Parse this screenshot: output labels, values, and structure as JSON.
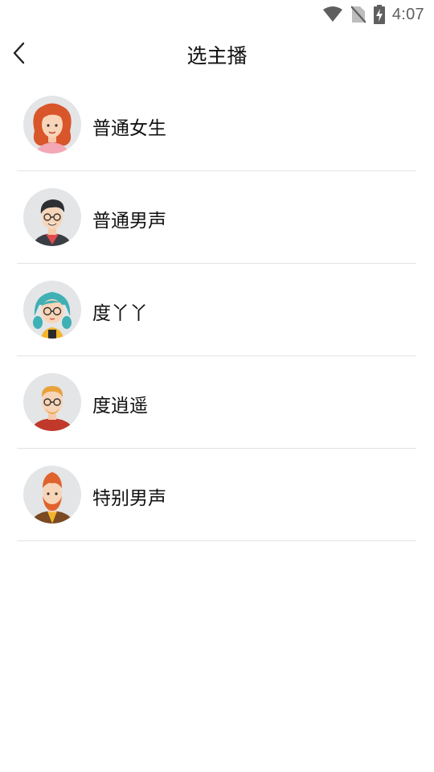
{
  "status_bar": {
    "time": "4:07",
    "icons": [
      "wifi-icon",
      "no-sim-icon",
      "battery-charging-icon"
    ],
    "icon_color": "#5f5f5f"
  },
  "header": {
    "back_icon": "chevron-left-icon",
    "title": "选主播"
  },
  "voices": [
    {
      "name": "普通女生",
      "avatar": "avatar-woman-red-hair"
    },
    {
      "name": "普通男声",
      "avatar": "avatar-man-glasses"
    },
    {
      "name": "度丫丫",
      "avatar": "avatar-girl-teal-hair"
    },
    {
      "name": "度逍遥",
      "avatar": "avatar-man-blond-glasses"
    },
    {
      "name": "特别男声",
      "avatar": "avatar-man-ginger-beard"
    }
  ],
  "colors": {
    "avatar_background": "#e3e5e7",
    "divider": "#e3e3e3",
    "text": "#111111"
  }
}
